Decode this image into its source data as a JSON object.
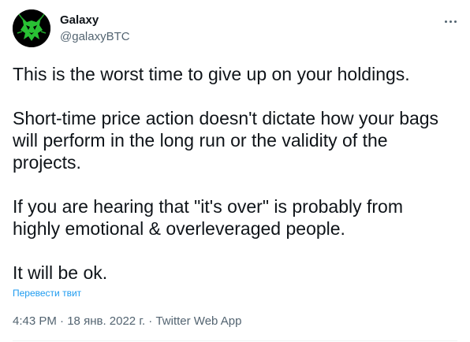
{
  "user": {
    "display_name": "Galaxy",
    "handle": "@galaxyBTC"
  },
  "tweet": {
    "paragraphs": [
      "This is the worst time to give up on your holdings.",
      "Short-time price action doesn't dictate how your bags\nwill perform in the long run or the validity of the\nprojects.",
      "If you are hearing that \"it's over\" is probably from\nhighly emotional & overleveraged people.",
      "It will be ok."
    ],
    "translate_label": "Перевести твит"
  },
  "meta": {
    "time": "4:43 PM",
    "separator": " · ",
    "date": "18 янв. 2022 г.",
    "source": "Twitter Web App"
  },
  "icons": {
    "more": "more-horizontal-icon",
    "avatar": "green-skull-avatar"
  },
  "colors": {
    "text_primary": "#0f1419",
    "text_secondary": "#536471",
    "link": "#1d9bf0",
    "avatar_bg": "#000000",
    "avatar_fg": "#2dd63a"
  }
}
